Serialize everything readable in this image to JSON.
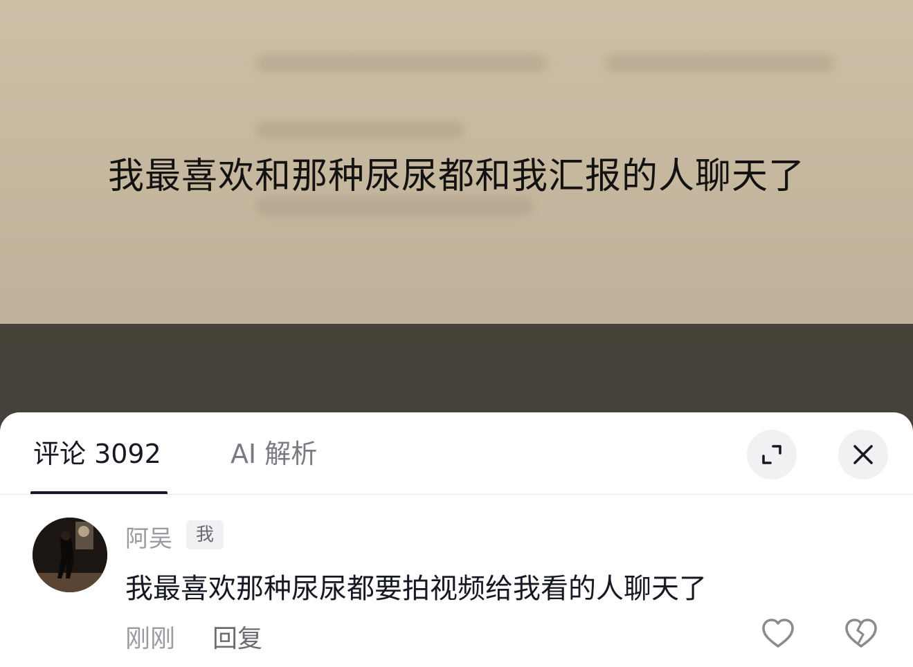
{
  "video": {
    "caption": "我最喜欢和那种尿尿都和我汇报的人聊天了"
  },
  "comments_panel": {
    "tabs": [
      {
        "label": "评论 3092"
      },
      {
        "label": "AI 解析"
      }
    ],
    "expand_icon": "expand-icon",
    "close_icon": "close-icon"
  },
  "comment": {
    "username": "阿吴",
    "badge": "我",
    "text": "我最喜欢那种尿尿都要拍视频给我看的人聊天了",
    "time": "刚刚",
    "reply_label": "回复",
    "like_icon": "heart-icon",
    "dislike_icon": "broken-heart-icon"
  }
}
